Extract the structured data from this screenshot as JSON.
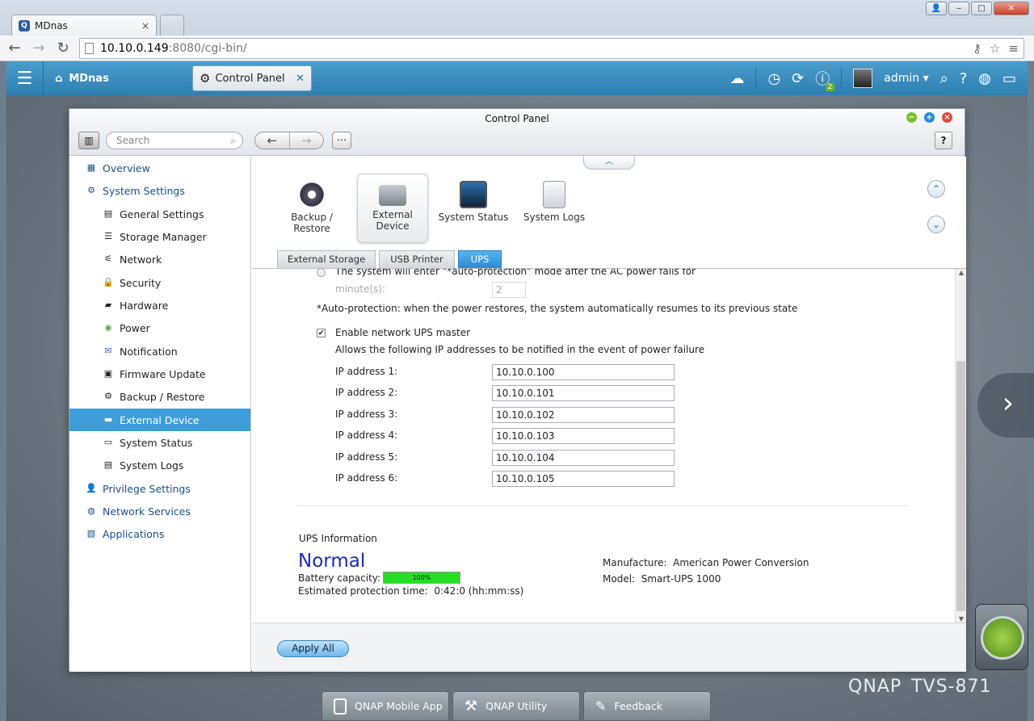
{
  "browser": {
    "tab_title": "MDnas",
    "tab_close": "×",
    "url_host": "10.10.0.149",
    "url_path": ":8080/cgi-bin/",
    "back": "←",
    "forward": "→",
    "reload": "↻"
  },
  "app": {
    "home_label": "MDnas",
    "open_tab": "Control Panel",
    "user": "admin",
    "notification_count": "2",
    "accent_color": "#3d9ed9"
  },
  "window": {
    "title": "Control Panel",
    "search_placeholder": "Search",
    "help": "?"
  },
  "sidebar": {
    "items": [
      {
        "label": "Overview",
        "level": "top"
      },
      {
        "label": "System Settings",
        "level": "top"
      },
      {
        "label": "General Settings",
        "level": "sub"
      },
      {
        "label": "Storage Manager",
        "level": "sub"
      },
      {
        "label": "Network",
        "level": "sub"
      },
      {
        "label": "Security",
        "level": "sub"
      },
      {
        "label": "Hardware",
        "level": "sub"
      },
      {
        "label": "Power",
        "level": "sub"
      },
      {
        "label": "Notification",
        "level": "sub"
      },
      {
        "label": "Firmware Update",
        "level": "sub"
      },
      {
        "label": "Backup / Restore",
        "level": "sub"
      },
      {
        "label": "External Device",
        "level": "sub",
        "active": true
      },
      {
        "label": "System Status",
        "level": "sub"
      },
      {
        "label": "System Logs",
        "level": "sub"
      },
      {
        "label": "Privilege Settings",
        "level": "top"
      },
      {
        "label": "Network Services",
        "level": "top"
      },
      {
        "label": "Applications",
        "level": "top"
      }
    ]
  },
  "tools": [
    {
      "label1": "Backup /",
      "label2": "Restore"
    },
    {
      "label1": "External",
      "label2": "Device",
      "selected": true
    },
    {
      "label1": "System Status",
      "label2": ""
    },
    {
      "label1": "System Logs",
      "label2": ""
    }
  ],
  "subtabs": [
    "External Storage",
    "USB Printer",
    "UPS"
  ],
  "ups": {
    "auto_protection_text": "The system will enter \"*auto-protection\" mode after the AC power fails for",
    "minutes_label": "minute(s):",
    "minutes_value": "2",
    "auto_protection_note": "*Auto-protection: when the power restores, the system automatically resumes to its previous state",
    "enable_master_label": "Enable network UPS master",
    "enable_master_checked": true,
    "allows_text": "Allows the following IP addresses to be notified in the event of power failure",
    "ip_labels": [
      "IP address 1:",
      "IP address 2:",
      "IP address 3:",
      "IP address 4:",
      "IP address 5:",
      "IP address 6:"
    ],
    "ip_values": [
      "10.10.0.100",
      "10.10.0.101",
      "10.10.0.102",
      "10.10.0.103",
      "10.10.0.104",
      "10.10.0.105"
    ],
    "info_heading": "UPS Information",
    "status": "Normal",
    "battery_label": "Battery capacity:",
    "battery_percent": "100%",
    "battery_fraction": 1.0,
    "protection_label": "Estimated protection time:",
    "protection_value": "0:42:0 (hh:mm:ss)",
    "manufacture_label": "Manufacture:",
    "manufacture_value": "American Power Conversion",
    "model_label": "Model:",
    "model_value": "Smart-UPS 1000"
  },
  "apply_label": "Apply All",
  "dock": [
    "QNAP Mobile App",
    "QNAP Utility",
    "Feedback"
  ],
  "brand": {
    "logo": "QNAP",
    "model": "TVS-871"
  }
}
